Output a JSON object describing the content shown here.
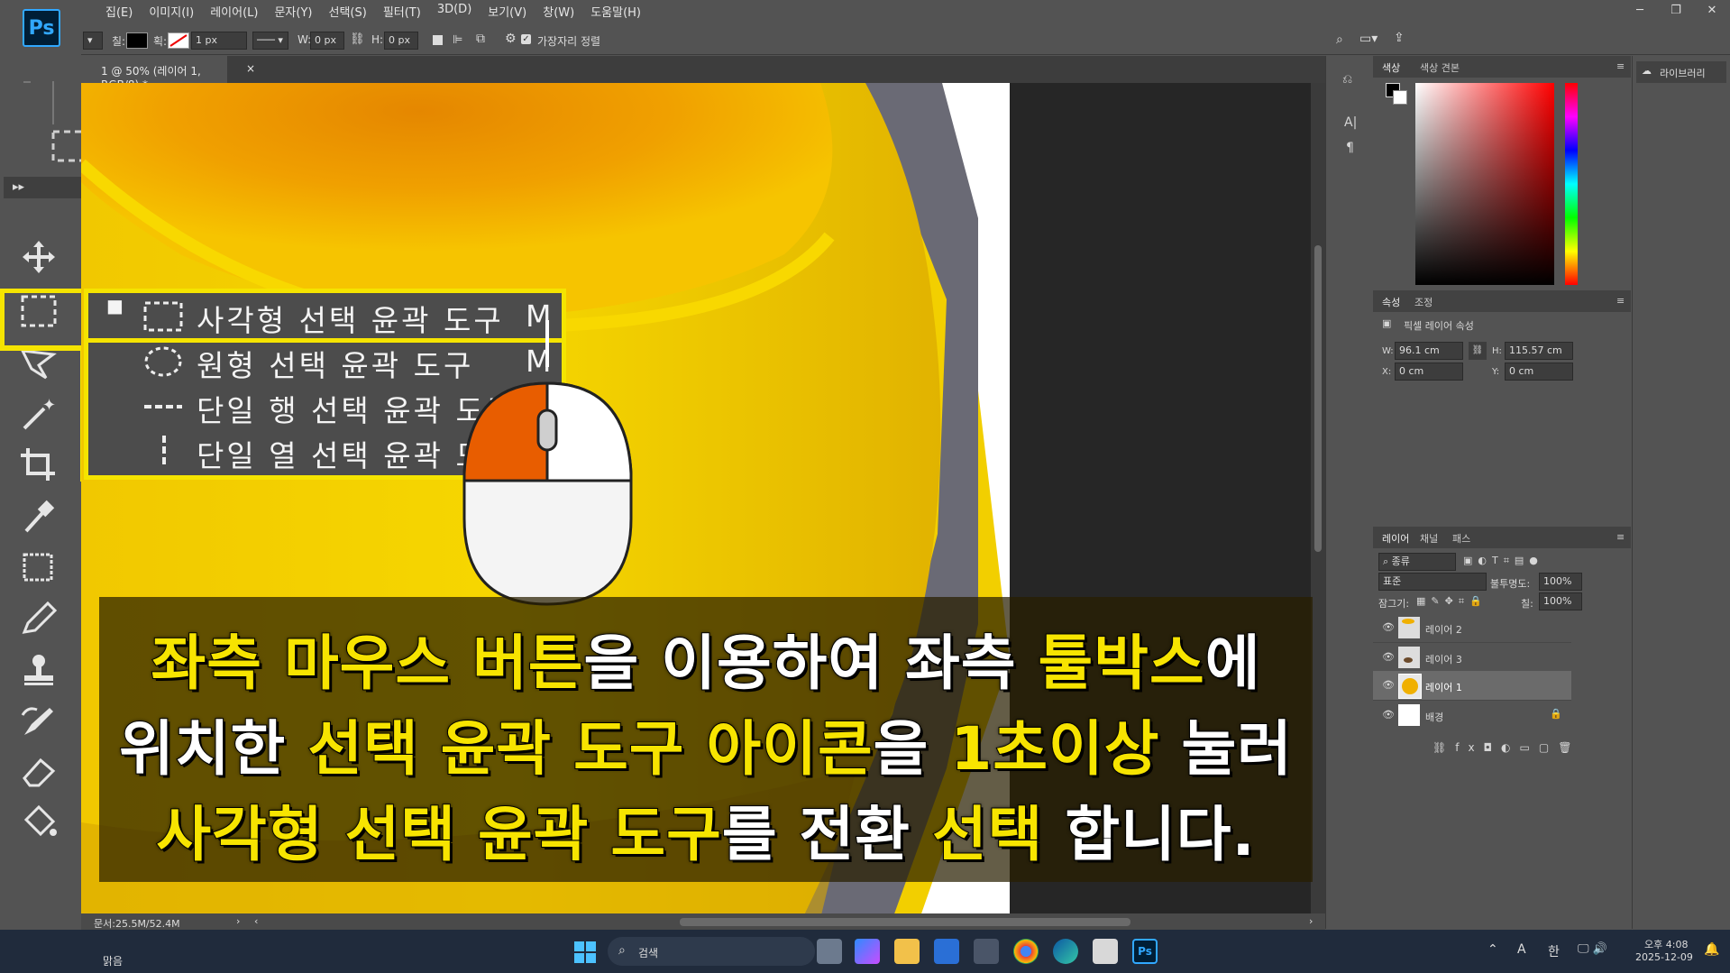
{
  "app": {
    "logo": "Ps"
  },
  "menu": [
    "집(E)",
    "이미지(I)",
    "레이어(L)",
    "문자(Y)",
    "선택(S)",
    "필터(T)",
    "3D(D)",
    "보기(V)",
    "창(W)",
    "도움말(H)"
  ],
  "options": {
    "fill_label": "칠:",
    "stroke_label": "획:",
    "stroke_width": "1 px",
    "w_label": "W:",
    "w_value": "0 px",
    "h_label": "H:",
    "h_value": "0 px",
    "align_edges": "가장자리 정렬"
  },
  "document": {
    "tab": "1 @ 50% (레이어 1, RGB/8) *",
    "close": "×"
  },
  "status": {
    "doc_size": "문서:25.5M/52.4M"
  },
  "flyout": {
    "items": [
      {
        "label": "사각형 선택 윤곽 도구",
        "key": "M",
        "active": true
      },
      {
        "label": "원형 선택 윤곽 도구",
        "key": "M"
      },
      {
        "label": "단일 행 선택 윤곽 도구",
        "key": ""
      },
      {
        "label": "단일 열 선택 윤곽 도구",
        "key": ""
      }
    ]
  },
  "caption": {
    "l1a": "좌측 마우스 버튼",
    "l1b": "을 이용하여 좌측 ",
    "l1c": "툴박스",
    "l1d": "에",
    "l2a": "위치한 ",
    "l2b": "선택 윤곽 도구 아이콘",
    "l2c": "을 ",
    "l2d": "1초이상",
    "l2e": " 눌러",
    "l3a": "사각형 선택 윤곽 도구",
    "l3b": "를 전환 ",
    "l3c": "선택",
    "l3d": " 합니다."
  },
  "color_panel": {
    "tabs": [
      "색상",
      "색상 견본"
    ]
  },
  "properties_panel": {
    "tabs": [
      "속성",
      "조정"
    ],
    "title": "픽셀 레이어 속성",
    "w_label": "W:",
    "w_value": "96.1 cm",
    "h_label": "H:",
    "h_value": "115.57 cm",
    "x_label": "X:",
    "x_value": "0 cm",
    "y_label": "Y:",
    "y_value": "0 cm"
  },
  "layers_panel": {
    "tabs": [
      "레이어",
      "채널",
      "패스"
    ],
    "filter": "종류",
    "blend_mode": "표준",
    "opacity_label": "불투명도:",
    "opacity": "100%",
    "lock_label": "잠그기:",
    "fill_label": "칠:",
    "fill": "100%",
    "layers": [
      {
        "name": "레이어 2"
      },
      {
        "name": "레이어 3"
      },
      {
        "name": "레이어 1",
        "selected": true
      },
      {
        "name": "배경",
        "locked": true
      }
    ]
  },
  "libraries": {
    "label": "라이브러리"
  },
  "taskbar": {
    "weather": "맑음",
    "search": "검색",
    "ime_a": "A",
    "ime_han": "한",
    "time": "오후 4:08",
    "date": "2025-12-09"
  },
  "colors": {
    "highlight": "#f7e400",
    "mouse_left": "#e85d00",
    "ps_blue": "#31a8ff"
  }
}
